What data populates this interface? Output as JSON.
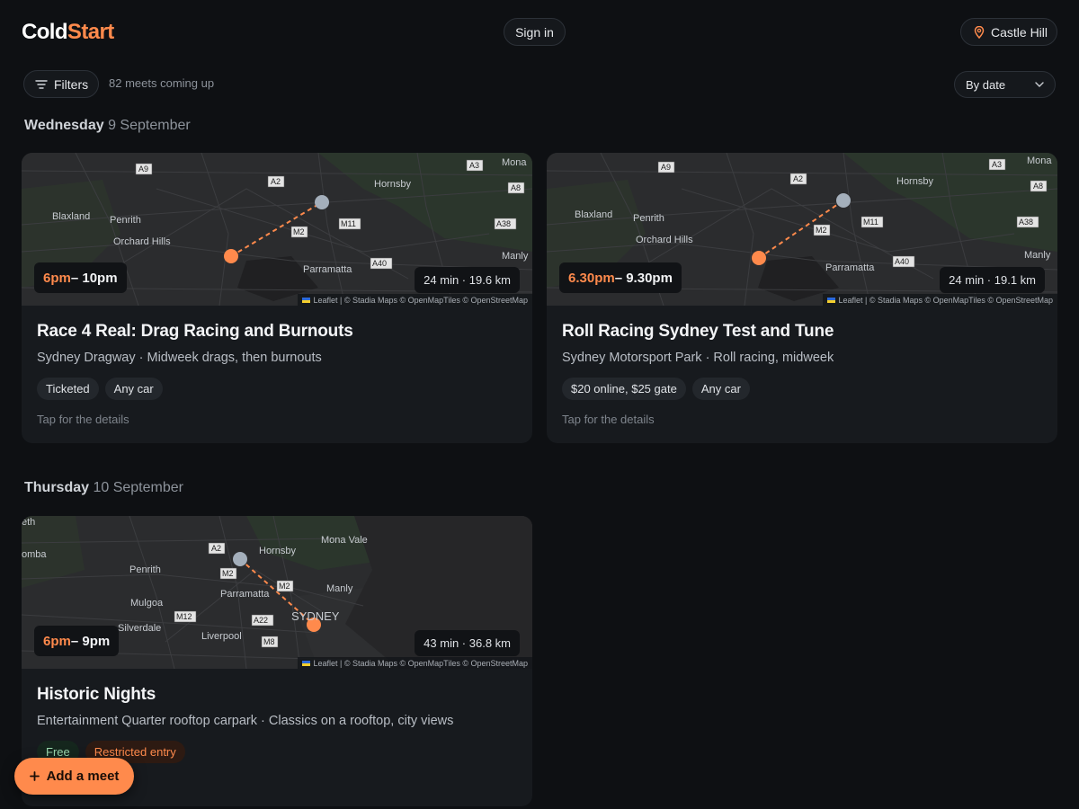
{
  "header": {
    "logo_part1": "Cold",
    "logo_part2": "Start",
    "signin_label": "Sign in",
    "location_label": "Castle Hill",
    "location_icon": "map-pin-icon"
  },
  "controls": {
    "filters_label": "Filters",
    "filters_icon": "filter-lines-icon",
    "count_text": "82 meets coming up",
    "sort_label": "By date",
    "sort_icon": "chevron-down-icon"
  },
  "days": [
    {
      "weekday": "Wednesday",
      "date": "9 September",
      "meets": [
        {
          "time_start": "6pm",
          "time_end": " – 10pm",
          "distance": "24 min · 19.6 km",
          "title": "Race 4 Real: Drag Racing and Burnouts",
          "subtitle": "Sydney Dragway · Midweek drags, then burnouts",
          "tags": [
            {
              "label": "Ticketed"
            },
            {
              "label": "Any car"
            }
          ],
          "details": "Tap for the details",
          "attribution": "Leaflet | © Stadia Maps © OpenMapTiles © OpenStreetMap"
        },
        {
          "time_start": "6.30pm",
          "time_end": " – 9.30pm",
          "distance": "24 min · 19.1 km",
          "title": "Roll Racing Sydney Test and Tune",
          "subtitle": "Sydney Motorsport Park · Roll racing, midweek",
          "tags": [
            {
              "label": "$20 online, $25 gate"
            },
            {
              "label": "Any car"
            }
          ],
          "details": "Tap for the details",
          "attribution": "Leaflet | © Stadia Maps © OpenMapTiles © OpenStreetMap"
        }
      ]
    },
    {
      "weekday": "Thursday",
      "date": "10 September",
      "meets": [
        {
          "time_start": "6pm",
          "time_end": " – 9pm",
          "distance": "43 min · 36.8 km",
          "title": "Historic Nights",
          "subtitle": "Entertainment Quarter rooftop carpark · Classics on a rooftop, city views",
          "tags": [
            {
              "label": "Free"
            },
            {
              "label": "Restricted entry"
            }
          ],
          "attribution": "Leaflet | © Stadia Maps © OpenMapTiles © OpenStreetMap"
        }
      ]
    }
  ],
  "map_labels_a": {
    "places": [
      "Mona",
      "Hornsby",
      "Blaxland",
      "Penrith",
      "Orchard Hills",
      "Parramatta",
      "Manly"
    ],
    "roads": [
      "A9",
      "A2",
      "A3",
      "A8",
      "M11",
      "A38",
      "M2",
      "A40"
    ]
  },
  "map_labels_c": {
    "places": [
      "Mona Vale",
      "Hornsby",
      "Penrith",
      "Mulgoa",
      "Silverdale",
      "Parramatta",
      "Manly",
      "SYDNEY",
      "Liverpool",
      "eth",
      "omba"
    ],
    "roads": [
      "A2",
      "M2",
      "M12",
      "A22",
      "M8"
    ]
  },
  "fab": {
    "label": "Add a meet",
    "icon": "plus-icon"
  },
  "colors": {
    "accent": "#ff8a4c",
    "background": "#0e1013",
    "card": "#171a1e"
  }
}
